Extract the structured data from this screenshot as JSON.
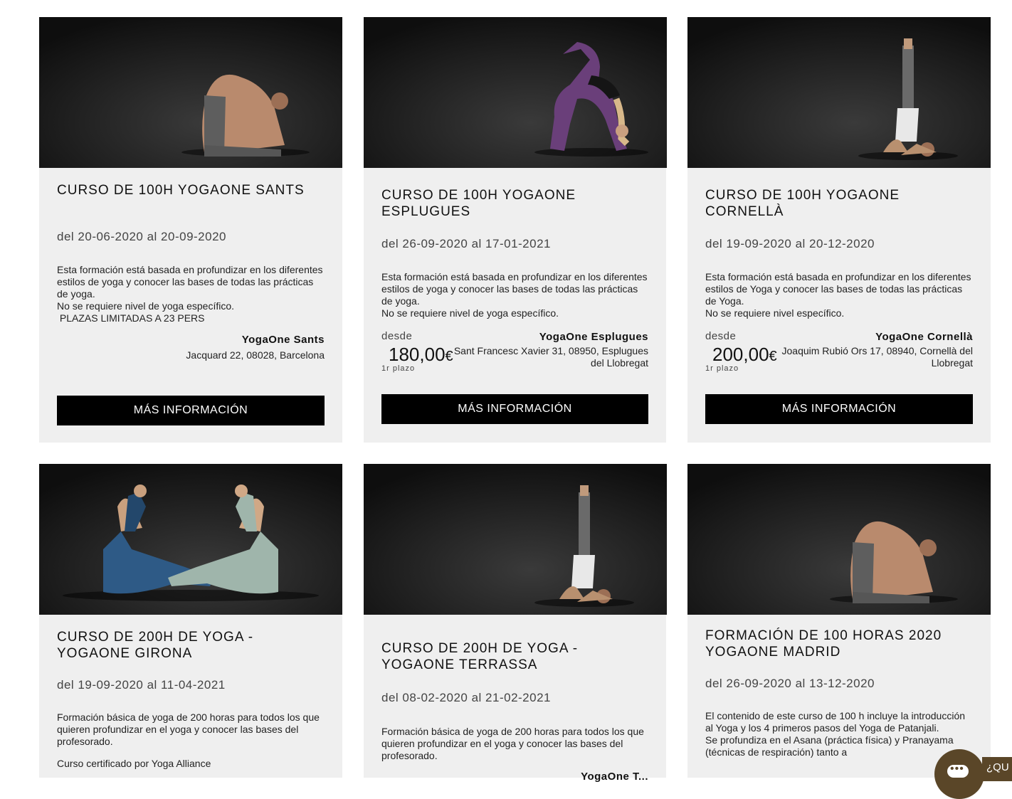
{
  "cards": [
    {
      "title": "CURSO DE 100H YOGAONE SANTS",
      "dates": "del 20-06-2020 al 20-09-2020",
      "desc": [
        "Esta formación está basada en profundizar en los diferentes estilos de yoga y conocer las bases de todas las prácticas de yoga.",
        "No se requiere nivel de yoga específico.",
        " PLAZAS LIMITADAS A 23 PERS"
      ],
      "location_name": "YogaOne Sants",
      "location_address": "Jacquard 22, 08028, Barcelona",
      "button_label": "MÁS INFORMACIÓN",
      "image": "yoga-camel-pose-man"
    },
    {
      "title": "CURSO DE 100H YOGAONE ESPLUGUES",
      "dates": "del 26-09-2020 al 17-01-2021",
      "desc": [
        "Esta formación está basada en profundizar en los diferentes estilos de yoga y conocer las bases de todas las prácticas de yoga.",
        "No se requiere nivel de yoga específico."
      ],
      "price_prefix": "desde",
      "price": "180,00",
      "currency": "€",
      "price_note": "1r plazo",
      "location_name": "YogaOne Esplugues",
      "location_address": "Sant Francesc Xavier 31, 08950, Esplugues del Llobregat",
      "button_label": "MÁS INFORMACIÓN",
      "image": "yoga-wheel-pose-woman"
    },
    {
      "title": "CURSO DE 100H YOGAONE CORNELLÀ",
      "dates": "del 19-09-2020 al 20-12-2020",
      "desc": [
        "Esta formación está basada en profundizar en los diferentes estilos de Yoga y conocer las bases de todas las prácticas de Yoga.",
        "No se requiere nivel específico."
      ],
      "price_prefix": "desde",
      "price": "200,00",
      "currency": "€",
      "price_note": "1r plazo",
      "location_name": "YogaOne Cornellà",
      "location_address": "Joaquim Rubió Ors 17, 08940, Cornellà del Llobregat",
      "button_label": "MÁS INFORMACIÓN",
      "image": "yoga-shoulder-stand-man"
    },
    {
      "title": "CURSO DE 200H DE YOGA - YOGAONE GIRONA",
      "dates": "del 19-09-2020 al 11-04-2021",
      "desc": [
        "Formación básica de yoga de 200 horas para todos los que quieren profundizar en el yoga y conocer las bases del profesorado.",
        "",
        "Curso certificado por Yoga Alliance"
      ],
      "image": "yoga-two-women-pigeon-pose"
    },
    {
      "title": "CURSO DE 200H DE YOGA - YOGAONE TERRASSA",
      "dates": "del 08-02-2020 al 21-02-2021",
      "desc": [
        "Formación básica de yoga de 200 horas para todos los que quieren profundizar en el yoga y conocer las bases del profesorado."
      ],
      "location_name": "YogaOne T...",
      "image": "yoga-shoulder-stand-man"
    },
    {
      "title": "FORMACIÓN DE 100 HORAS 2020 YOGAONE MADRID",
      "dates": "del 26-09-2020 al 13-12-2020",
      "desc": [
        "El contenido de este curso de 100 h incluye la introducción al Yoga y los 4 primeros pasos del Yoga de Patanjali.",
        "Se profundiza en el Asana (práctica física) y Pranayama (técnicas de respiración) tanto a"
      ],
      "image": "yoga-camel-pose-man"
    }
  ],
  "chat": {
    "label": "¿QU",
    "icon": "chat-bubble-icon",
    "color": "#5a4628"
  }
}
